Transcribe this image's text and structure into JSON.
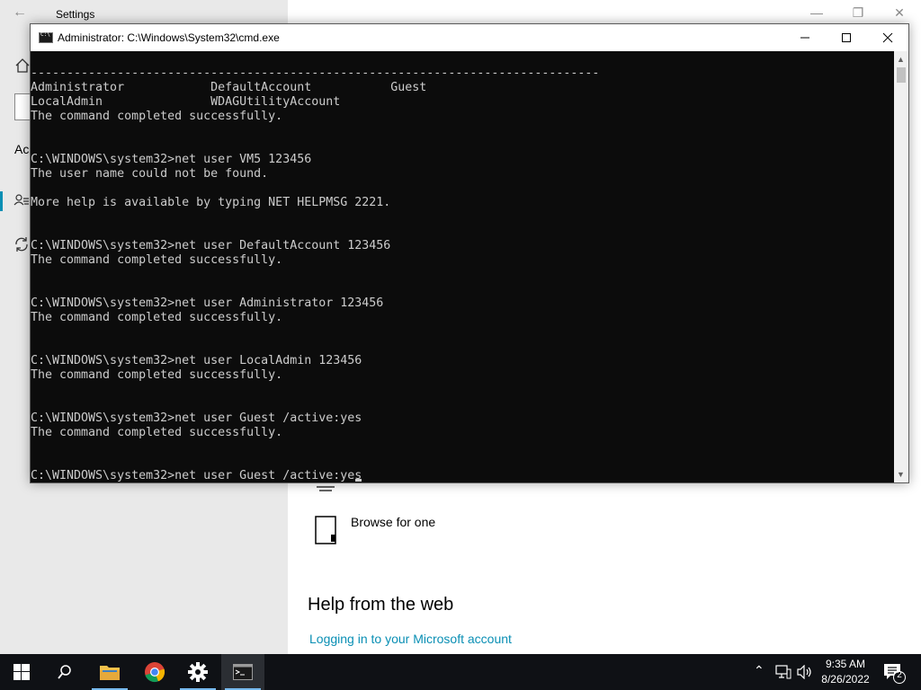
{
  "settings": {
    "title": "Settings",
    "left_fragment": "Ac",
    "browse_label": "Browse for one",
    "help_title": "Help from the web",
    "help_link": "Logging in to your Microsoft account",
    "accent_color": "#0a8fb4"
  },
  "cmd": {
    "title": "Administrator: C:\\Windows\\System32\\cmd.exe",
    "lines": [
      "-------------------------------------------------------------------------------",
      "Administrator            DefaultAccount           Guest",
      "LocalAdmin               WDAGUtilityAccount",
      "The command completed successfully.",
      "",
      "",
      "C:\\WINDOWS\\system32>net user VM5 123456",
      "The user name could not be found.",
      "",
      "More help is available by typing NET HELPMSG 2221.",
      "",
      "",
      "C:\\WINDOWS\\system32>net user DefaultAccount 123456",
      "The command completed successfully.",
      "",
      "",
      "C:\\WINDOWS\\system32>net user Administrator 123456",
      "The command completed successfully.",
      "",
      "",
      "C:\\WINDOWS\\system32>net user LocalAdmin 123456",
      "The command completed successfully.",
      "",
      "",
      "C:\\WINDOWS\\system32>net user Guest /active:yes",
      "The command completed successfully.",
      "",
      "",
      "C:\\WINDOWS\\system32>net user Guest /active:yes"
    ]
  },
  "taskbar": {
    "time": "9:35 AM",
    "date": "8/26/2022",
    "notification_count": "2",
    "icons": [
      "windows-start-icon",
      "search-icon",
      "file-explorer-icon",
      "chrome-icon",
      "settings-gear-icon",
      "command-prompt-icon"
    ]
  }
}
